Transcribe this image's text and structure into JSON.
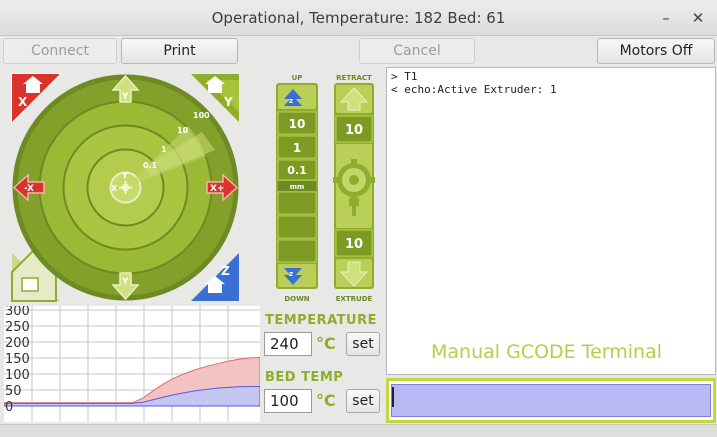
{
  "window": {
    "title": "Operational, Temperature: 182 Bed: 61",
    "minimize_glyph": "–",
    "close_glyph": "✕"
  },
  "toolbar": {
    "connect_label": "Connect",
    "print_label": "Print",
    "cancel_label": "Cancel",
    "motors_off_label": "Motors Off"
  },
  "xy_pad": {
    "home_x_label": "X",
    "home_y_label": "Y",
    "home_z_label": "Z",
    "home_all_label": "",
    "x_minus_label": "-X",
    "x_plus_label": "X+",
    "y_plus_label": "Y",
    "y_minus_label": "Y",
    "center_x_label": "X",
    "center_y_label": "Y",
    "step_labels": [
      "0.1",
      "1",
      "10",
      "100"
    ]
  },
  "z_pad": {
    "up_label": "UP",
    "down_label": "DOWN",
    "steps": [
      "10",
      "1",
      "0.1"
    ],
    "mm_label": "mm"
  },
  "extruder": {
    "retract_label": "RETRACT",
    "extrude_label": "EXTRUDE",
    "retract_amount": "10",
    "extrude_amount": "10"
  },
  "temperature": {
    "label": "TEMPERATURE",
    "value": "240",
    "unit": "°C",
    "set_label": "set"
  },
  "bed": {
    "label": "BED TEMP",
    "value": "100",
    "unit": "°C",
    "set_label": "set"
  },
  "console": {
    "lines": [
      "> T1",
      "< echo:Active Extruder: 1"
    ],
    "terminal_label": "Manual GCODE Terminal",
    "input_value": ""
  },
  "colors": {
    "accent_green": "#8fac2b",
    "ring_dark": "#83a02a",
    "ring_mid": "#9ab935",
    "ring_light": "#b4cc4d",
    "arrow_red": "#d9332b",
    "arrow_blue": "#3a6fd4",
    "temp_fill": "#f3c3c3",
    "bed_fill": "#c4c6f2",
    "terminal_input": "#b8b8f5"
  },
  "chart_data": {
    "type": "area",
    "yticks": [
      "300",
      "250",
      "200",
      "150",
      "100",
      "50",
      "0"
    ],
    "ylim": [
      0,
      300
    ],
    "grid": true,
    "series": [
      {
        "values": [
          10,
          10,
          10,
          10,
          10,
          10,
          10,
          10,
          10,
          10,
          10,
          10,
          10,
          24,
          48,
          70,
          88,
          102,
          114,
          124,
          132,
          140,
          146,
          150,
          152
        ]
      },
      {
        "values": [
          8,
          8,
          8,
          8,
          8,
          8,
          8,
          8,
          8,
          8,
          8,
          8,
          8,
          12,
          20,
          28,
          36,
          42,
          48,
          52,
          56,
          58,
          60,
          61,
          61
        ]
      }
    ]
  }
}
